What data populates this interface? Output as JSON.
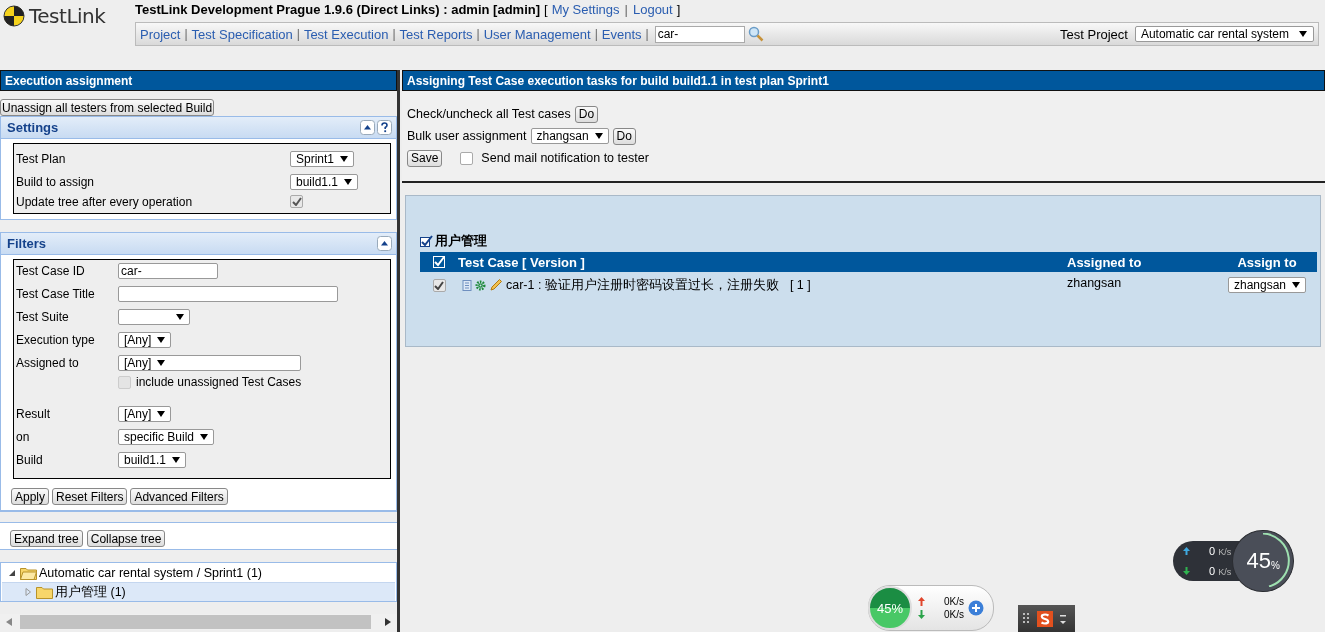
{
  "header": {
    "logo": "TestLink",
    "title": "TestLink Development Prague 1.9.6 (Direct Links) : admin [admin]",
    "bracket_open": "[",
    "links": [
      {
        "label": "My Settings",
        "separator": "|"
      },
      {
        "label": "Logout"
      }
    ],
    "bracket_close": "]",
    "nav": [
      {
        "label": "Project",
        "separator": "|"
      },
      {
        "label": "Test Specification",
        "separator": "|"
      },
      {
        "label": "Test Execution",
        "separator": "|"
      },
      {
        "label": "Test Reports",
        "separator": "|"
      },
      {
        "label": "User Management",
        "separator": "|"
      },
      {
        "label": "Events",
        "separator": "|"
      }
    ],
    "search": {
      "value": "car-"
    },
    "project_label": "Test Project",
    "project": "Automatic car rental system"
  },
  "left": {
    "title": "Execution assignment",
    "unassign_button": "Unassign all testers from selected Build",
    "settings": {
      "title": "Settings",
      "rows": [
        {
          "kind": "select",
          "label": "Test Plan",
          "value": "Sprint1"
        },
        {
          "kind": "select",
          "label": "Build to assign",
          "value": "build1.1"
        },
        {
          "kind": "checkbox",
          "label": "Update tree after every operation",
          "checked": true
        }
      ]
    },
    "filters": {
      "title": "Filters",
      "rows": [
        {
          "kind": "input",
          "label": "Test Case ID",
          "value": "car-"
        },
        {
          "kind": "input",
          "label": "Test Case Title",
          "value": ""
        },
        {
          "kind": "select",
          "label": "Test Suite",
          "value": ""
        },
        {
          "kind": "select",
          "label": "Execution type",
          "value": "[Any]"
        },
        {
          "kind": "select_checkbox",
          "label": "Assigned to",
          "value": "[Any]",
          "option": "include unassigned Test Cases",
          "checked": false,
          "disabled": true
        },
        {
          "kind": "select",
          "label": "Result",
          "value": "[Any]"
        },
        {
          "kind": "select",
          "label": "on",
          "value": "specific Build"
        },
        {
          "kind": "select",
          "label": "Build",
          "value": "build1.1"
        }
      ],
      "buttons": [
        "Apply",
        "Reset Filters",
        "Advanced Filters"
      ]
    },
    "tree_buttons": [
      "Expand tree",
      "Collapse tree"
    ],
    "tree": [
      {
        "label": "Automatic car rental system / Sprint1 (1)",
        "expanded": true,
        "selected": false,
        "children": [
          {
            "label": "用户管理 (1)",
            "expanded": false,
            "selected": true
          }
        ]
      }
    ]
  },
  "right": {
    "title": "Assigning Test Case execution tasks for build build1.1 in test plan Sprint1",
    "check_all": {
      "label": "Check/uncheck all Test cases",
      "button": "Do"
    },
    "bulk": {
      "label": "Bulk user assignment",
      "value": "zhangsan",
      "button": "Do"
    },
    "save_button": "Save",
    "send_mail": {
      "label": "Send mail notification to tester",
      "checked": false
    },
    "suite": {
      "name": "用户管理",
      "checked": true,
      "columns": [
        "Test Case [ Version ]",
        "Assigned to",
        "Assign to"
      ],
      "all_checked": true,
      "rows": [
        {
          "checked": true,
          "title": "car-1 : 验证用户注册时密码设置过长，注册失败",
          "version": "[ 1 ]",
          "assigned": "zhangsan",
          "assign": "zhangsan"
        }
      ]
    }
  },
  "widgets": {
    "ball": {
      "percent": "45%",
      "up": "0K/s",
      "down": "0K/s"
    },
    "ring": {
      "up": "0",
      "down": "0",
      "unit_up": "K/s",
      "unit_down": "K/s",
      "value": "45",
      "unit": "%"
    }
  }
}
